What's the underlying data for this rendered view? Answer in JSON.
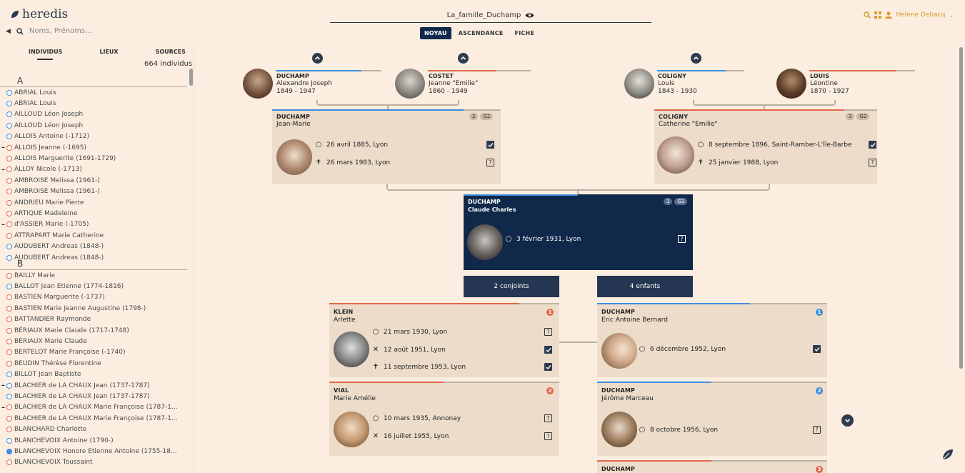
{
  "app": {
    "logo": "heredis"
  },
  "search": {
    "placeholder": "Noms, Prénoms..."
  },
  "tree": {
    "title": "La_famille_Duchamp"
  },
  "view_tabs": [
    {
      "label": "NOYAU"
    },
    {
      "label": "ASCENDANCE"
    },
    {
      "label": "FICHE"
    }
  ],
  "user": {
    "name": "Helene Debacq"
  },
  "sidebar": {
    "tabs": [
      {
        "label": "INDIVIDUS"
      },
      {
        "label": "LIEUX"
      },
      {
        "label": "SOURCES"
      }
    ],
    "count": "664 individus",
    "sections": [
      {
        "letter": "A",
        "people": [
          {
            "name": "ABRIAL Louis",
            "years": "",
            "sex": "m",
            "minus": false
          },
          {
            "name": "ABRIAL Louis",
            "years": "",
            "sex": "m",
            "minus": false
          },
          {
            "name": "AILLOUD Léon Joseph",
            "years": "",
            "sex": "m",
            "minus": false
          },
          {
            "name": "AILLOUD Léon Joseph",
            "years": "",
            "sex": "m",
            "minus": false
          },
          {
            "name": "ALLOIS Antoine",
            "years": "(-1712)",
            "sex": "m",
            "minus": false
          },
          {
            "name": "ALLOIS Jeanne",
            "years": "(-1695)",
            "sex": "f",
            "minus": true
          },
          {
            "name": "ALLOIS Marguerite",
            "years": "(1691-1729)",
            "sex": "f",
            "minus": false
          },
          {
            "name": "ALLOY Nicole",
            "years": "(-1713)",
            "sex": "f",
            "minus": true
          },
          {
            "name": "AMBROISE Melissa",
            "years": "(1961-)",
            "sex": "f",
            "minus": false
          },
          {
            "name": "AMBROISE Melissa",
            "years": "(1961-)",
            "sex": "f",
            "minus": false
          },
          {
            "name": "ANDRIEU Marie Pierre",
            "years": "",
            "sex": "f",
            "minus": false
          },
          {
            "name": "ARTIQUE Madeleine",
            "years": "",
            "sex": "f",
            "minus": false
          },
          {
            "name": "d'ASSIER Marie",
            "years": "(-1705)",
            "sex": "f",
            "minus": true
          },
          {
            "name": "ATTRAPART Marie Catherine",
            "years": "",
            "sex": "f",
            "minus": false
          },
          {
            "name": "AUDUBERT Andreas",
            "years": "(1848-)",
            "sex": "m",
            "minus": false
          },
          {
            "name": "AUDUBERT Andreas",
            "years": "(1848-)",
            "sex": "m",
            "minus": false
          }
        ]
      },
      {
        "letter": "B",
        "people": [
          {
            "name": "BAILLY Marie",
            "years": "",
            "sex": "f",
            "minus": false
          },
          {
            "name": "BALLOT Jean Etienne",
            "years": "(1774-1816)",
            "sex": "m",
            "minus": false
          },
          {
            "name": "BASTIEN Marguerite",
            "years": "(-1737)",
            "sex": "f",
            "minus": false
          },
          {
            "name": "BASTIEN Marie Jeanne Augustine",
            "years": "(1798-)",
            "sex": "f",
            "minus": false
          },
          {
            "name": "BATTANDIER Raymonde",
            "years": "",
            "sex": "f",
            "minus": false
          },
          {
            "name": "BÉRIAUX Marie Claude",
            "years": "(1717-1748)",
            "sex": "f",
            "minus": false
          },
          {
            "name": "BÉRIAUX Marie Claude",
            "years": "",
            "sex": "f",
            "minus": false
          },
          {
            "name": "BERTELOT Marie Françoise",
            "years": "(-1740)",
            "sex": "f",
            "minus": false
          },
          {
            "name": "BEUDIN Thérèse Florentine",
            "years": "",
            "sex": "f",
            "minus": false
          },
          {
            "name": "BILLOT Jean Baptiste",
            "years": "",
            "sex": "m",
            "minus": false
          },
          {
            "name": "BLACHIER de LA CHAUX Jean",
            "years": "(1737-1787)",
            "sex": "m",
            "minus": true
          },
          {
            "name": "BLACHIER de LA CHAUX Jean",
            "years": "(1737-1787)",
            "sex": "m",
            "minus": false
          },
          {
            "name": "BLACHIER de LA CHAUX Marie Françoise",
            "years": "(1787-1...",
            "sex": "f",
            "minus": true
          },
          {
            "name": "BLACHIER de LA CHAUX Marie Françoise",
            "years": "(1787-1...",
            "sex": "f",
            "minus": false
          },
          {
            "name": "BLANCHARD Charlotte",
            "years": "",
            "sex": "f",
            "minus": false
          },
          {
            "name": "BLANCHEVOIX Antoine",
            "years": "(1790-)",
            "sex": "m",
            "minus": false
          },
          {
            "name": "BLANCHEVOIX Honore Etienne Antoine",
            "years": "(1755-18...",
            "sex": "mfill",
            "minus": false
          },
          {
            "name": "BLANCHEVOIX Toussaint",
            "years": "",
            "sex": "f",
            "minus": false
          }
        ]
      }
    ]
  },
  "grandparents": [
    {
      "surname": "DUCHAMP",
      "given": "Alexandre Joseph",
      "dates": "1849 - 1947"
    },
    {
      "surname": "COSTET",
      "given": "Jeanne \"Emilie\"",
      "dates": "1860 - 1949"
    },
    {
      "surname": "COLIGNY",
      "given": "Louis",
      "dates": "1843 - 1930"
    },
    {
      "surname": "LOUIS",
      "given": "Léontine",
      "dates": "1870 - 1927"
    }
  ],
  "father": {
    "surname": "DUCHAMP",
    "given": "Jean-Marie",
    "badge1": "2",
    "badge2": "G2",
    "birth": "26 avril 1885, Lyon",
    "death": "26 mars 1983, Lyon"
  },
  "mother": {
    "surname": "COLIGNY",
    "given": "Catherine \"Emilie\"",
    "badge1": "3",
    "badge2": "G2",
    "birth": "8 septembre 1896, Saint-Ramber-L'Île-Barbe",
    "death": "25 janvier 1988, Lyon"
  },
  "subject": {
    "surname": "DUCHAMP",
    "given": "Claude Charles",
    "badge1": "1",
    "badge2": "G1",
    "birth": "3 février 1931, Lyon"
  },
  "buttons": {
    "spouses": "2 conjoints",
    "children": "4 enfants"
  },
  "spouses": [
    {
      "surname": "KLEIN",
      "given": "Arlette",
      "num": "1",
      "birth": "21 mars 1930, Lyon",
      "marriage": "12 août 1951, Lyon",
      "death": "11 septembre 1953, Lyon"
    },
    {
      "surname": "VIAL",
      "given": "Marie Amélie",
      "num": "2",
      "birth": "10 mars 1935, Annonay",
      "marriage": "16 juillet 1955, Lyon"
    }
  ],
  "children": [
    {
      "surname": "DUCHAMP",
      "given": "Eric Antoine Bernard",
      "num": "1",
      "birth": "6 décembre 1952, Lyon"
    },
    {
      "surname": "DUCHAMP",
      "given": "Jérôme Marceau",
      "num": "2",
      "birth": "8 octobre 1956, Lyon"
    },
    {
      "surname": "DUCHAMP",
      "given": "",
      "num": "3"
    }
  ],
  "colors": {
    "male": "#3d8ee0",
    "female": "#e2664a",
    "navy": "#10284a",
    "accent": "#d89a2b"
  }
}
